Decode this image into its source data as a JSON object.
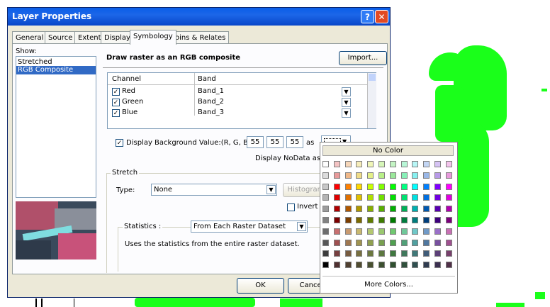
{
  "dialog": {
    "title": "Layer Properties",
    "help_glyph": "?",
    "close_glyph": "✕",
    "tabs": [
      "General",
      "Source",
      "Extent",
      "Display",
      "Symbology",
      "Joins & Relates"
    ],
    "active_tab": "Symbology"
  },
  "show": {
    "label": "Show:",
    "items": [
      "Stretched",
      "RGB Composite"
    ],
    "selected": "RGB Composite"
  },
  "main": {
    "heading": "Draw raster as an RGB composite",
    "import_label": "Import...",
    "channel_header": "Channel",
    "band_header": "Band",
    "channels": [
      {
        "channel": "Red",
        "band": "Band_1",
        "checked": true
      },
      {
        "channel": "Green",
        "band": "Band_2",
        "checked": true
      },
      {
        "channel": "Blue",
        "band": "Band_3",
        "checked": true
      }
    ],
    "check_glyph": "✓",
    "dropdown_glyph": "▼",
    "background_label": "Display Background Value:(R, G, B)",
    "background_values": [
      "55",
      "55",
      "55"
    ],
    "as_label": "as",
    "nodata_label": "Display NoData as",
    "stretch_group": "Stretch",
    "type_label": "Type:",
    "type_value": "None",
    "histogram_label": "Histograms",
    "invert_label": "Invert",
    "statistics_label": "Statistics :",
    "statistics_value": "From Each Raster Dataset",
    "statistics_desc": "Uses the statistics from the entire raster dataset."
  },
  "footer": {
    "ok_label": "OK",
    "cancel_label": "Cancel"
  },
  "palette": {
    "no_color_label": "No Color",
    "more_colors_label": "More Colors...",
    "columns": 12,
    "rows": [
      [
        "#ffffff",
        "#f4c3c3",
        "#f6d6b8",
        "#f6ecb8",
        "#f0f6b8",
        "#d6f6b8",
        "#c3f4c3",
        "#b8f6d6",
        "#b8f6f6",
        "#c3d6f4",
        "#d6c3f4",
        "#f4c3ec"
      ],
      [
        "#dcdcdc",
        "#e89a9a",
        "#f0b888",
        "#f0dc88",
        "#e4f088",
        "#b8f088",
        "#9ae89a",
        "#88f0b8",
        "#88f0f0",
        "#9ab8e8",
        "#b89ae8",
        "#e89adc"
      ],
      [
        "#c8c8c8",
        "#ff0000",
        "#ff8000",
        "#ffd800",
        "#c8ff00",
        "#80ff00",
        "#00ff00",
        "#00ff80",
        "#00ffff",
        "#0080ff",
        "#8000ff",
        "#ff00ff"
      ],
      [
        "#b4b4b4",
        "#e00000",
        "#e07000",
        "#e0c000",
        "#b0e000",
        "#70e000",
        "#00e000",
        "#00e070",
        "#00e0e0",
        "#0070e0",
        "#7000e0",
        "#e000e0"
      ],
      [
        "#9c9c9c",
        "#b00000",
        "#b05800",
        "#b09800",
        "#88b000",
        "#58b000",
        "#00b000",
        "#00b058",
        "#00b0b0",
        "#0058b0",
        "#5800b0",
        "#b000b0"
      ],
      [
        "#828282",
        "#7c0000",
        "#7c3e00",
        "#7c6a00",
        "#607c00",
        "#3e7c00",
        "#007c00",
        "#007c3e",
        "#007c7c",
        "#003e7c",
        "#3e007c",
        "#7c007c"
      ],
      [
        "#6e6e6e",
        "#c87070",
        "#c89a70",
        "#c8b870",
        "#b4c870",
        "#9ac870",
        "#70c870",
        "#70c89a",
        "#70c8c8",
        "#709ac8",
        "#9a70c8",
        "#c870b4"
      ],
      [
        "#585858",
        "#a05050",
        "#a07850",
        "#a09450",
        "#90a050",
        "#78a050",
        "#50a050",
        "#50a078",
        "#50a0a0",
        "#5078a0",
        "#7850a0",
        "#a05090"
      ],
      [
        "#3c3c3c",
        "#784040",
        "#785c40",
        "#787040",
        "#6c7840",
        "#5c7840",
        "#407840",
        "#40785c",
        "#407878",
        "#405c78",
        "#5c4078",
        "#78406c"
      ],
      [
        "#000000",
        "#503030",
        "#504030",
        "#504c30",
        "#485030",
        "#3c5030",
        "#305030",
        "#30503c",
        "#305050",
        "#303c50",
        "#3c3050",
        "#503048"
      ]
    ]
  },
  "colors": {
    "title_bar": "#0a5ee8",
    "selection": "#316ac5",
    "map_green": "#1aff1a"
  }
}
